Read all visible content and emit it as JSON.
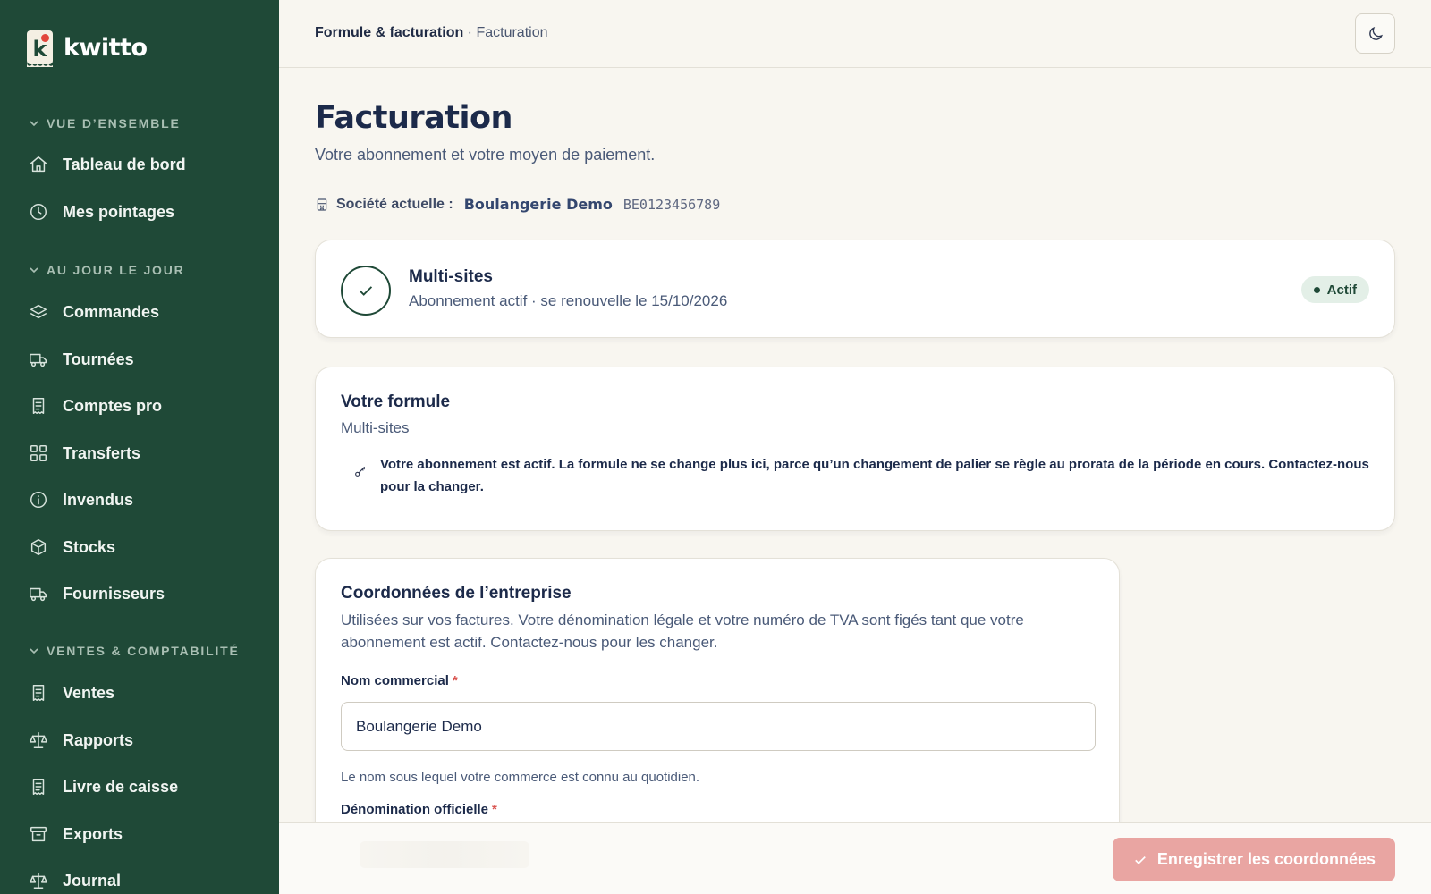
{
  "app": {
    "name": "kwitto",
    "logo_letter": "k"
  },
  "colors": {
    "sidebar": "#1f4937",
    "accent_red": "#e2463c",
    "save_button": "#e9a5a2",
    "badge_bg": "#e3efe7"
  },
  "sidebar": {
    "sections": [
      {
        "label": "VUE D’ENSEMBLE",
        "items": [
          {
            "label": "Tableau de bord",
            "icon": "home-icon"
          },
          {
            "label": "Mes pointages",
            "icon": "clock-icon"
          }
        ]
      },
      {
        "label": "AU JOUR LE JOUR",
        "items": [
          {
            "label": "Commandes",
            "icon": "layers-icon"
          },
          {
            "label": "Tournées",
            "icon": "truck-icon"
          },
          {
            "label": "Comptes pro",
            "icon": "receipt-icon"
          },
          {
            "label": "Transferts",
            "icon": "grid-icon"
          },
          {
            "label": "Invendus",
            "icon": "info-icon"
          },
          {
            "label": "Stocks",
            "icon": "box-icon"
          },
          {
            "label": "Fournisseurs",
            "icon": "truck-icon"
          }
        ]
      },
      {
        "label": "VENTES & COMPTABILITÉ",
        "items": [
          {
            "label": "Ventes",
            "icon": "receipt-icon"
          },
          {
            "label": "Rapports",
            "icon": "scale-icon"
          },
          {
            "label": "Livre de caisse",
            "icon": "receipt-icon"
          },
          {
            "label": "Exports",
            "icon": "archive-icon"
          },
          {
            "label": "Journal",
            "icon": "scale-icon"
          }
        ]
      }
    ]
  },
  "header": {
    "breadcrumb_parent": "Formule & facturation",
    "breadcrumb_sep": " · ",
    "breadcrumb_current": "Facturation",
    "theme_icon": "moon-icon"
  },
  "page": {
    "title": "Facturation",
    "subtitle": "Votre abonnement et votre moyen de paiement.",
    "company_label": "Société actuelle :",
    "company_name": "Boulangerie Demo",
    "company_vat": "BE0123456789"
  },
  "subscription": {
    "plan": "Multi-sites",
    "status_text": "Abonnement actif · se renouvelle le 15/10/2026",
    "badge": "Actif"
  },
  "plan_card": {
    "title": "Votre formule",
    "plan": "Multi-sites",
    "note": "Votre abonnement est actif. La formule ne se change plus ici, parce qu’un changement de palier se règle au prorata de la période en cours. Contactez-nous pour la changer."
  },
  "company_card": {
    "title": "Coordonnées de l’entreprise",
    "description": "Utilisées sur vos factures. Votre dénomination légale et votre numéro de TVA sont figés tant que votre abonnement est actif. Contactez-nous pour les changer.",
    "trade_name_label": "Nom commercial",
    "required_mark": "*",
    "trade_name_value": "Boulangerie Demo",
    "trade_name_help": "Le nom sous lequel votre commerce est connu au quotidien.",
    "official_name_label": "Dénomination officielle"
  },
  "footer": {
    "save_label": "Enregistrer les coordonnées"
  }
}
